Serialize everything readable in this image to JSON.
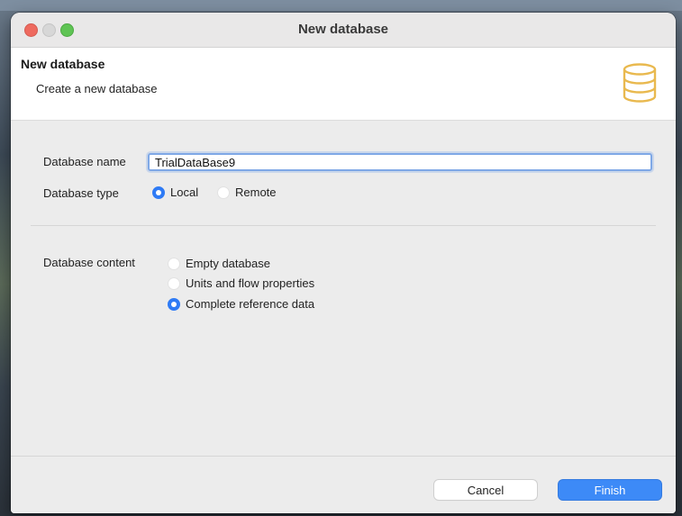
{
  "window": {
    "title": "New database"
  },
  "header": {
    "title": "New database",
    "subtitle": "Create a new database",
    "icon": "database-icon",
    "icon_color": "#e9b94f"
  },
  "form": {
    "name_label": "Database name",
    "name_value": "TrialDataBase9",
    "type_label": "Database type",
    "type_options": [
      {
        "label": "Local",
        "selected": true
      },
      {
        "label": "Remote",
        "selected": false
      }
    ],
    "content_label": "Database content",
    "content_options": [
      {
        "label": "Empty database",
        "selected": false
      },
      {
        "label": "Units and flow properties",
        "selected": false
      },
      {
        "label": "Complete reference data",
        "selected": true
      }
    ]
  },
  "footer": {
    "cancel_label": "Cancel",
    "finish_label": "Finish"
  },
  "colors": {
    "accent": "#2f7bf5",
    "primary_button": "#3d8af7"
  }
}
